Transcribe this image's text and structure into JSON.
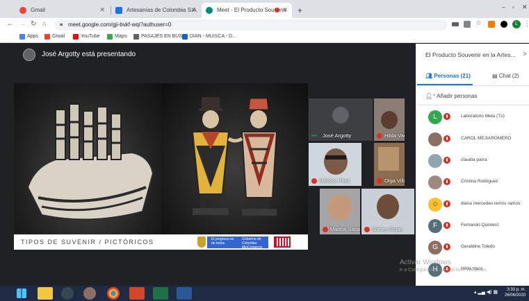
{
  "browser": {
    "tabs": [
      {
        "label": "Gmail",
        "active": false,
        "favicon_color": "#ea4335"
      },
      {
        "label": "Artesanías de Colombia S.A. - Co",
        "active": false,
        "favicon_color": "#1a73e8"
      },
      {
        "label": "Meet - El Producto Souvenir",
        "active": true,
        "favicon_color": "#00897b"
      }
    ],
    "new_tab": "+",
    "url": "meet.google.com/gji-bvkf-wqi?authuser=0",
    "profile_initial": "L",
    "bookmarks": [
      {
        "label": "Apps",
        "color": "#4285f4"
      },
      {
        "label": "Gmail",
        "color": "#ea4335"
      },
      {
        "label": "YouTube",
        "color": "#ff0000"
      },
      {
        "label": "Maps",
        "color": "#34a853"
      },
      {
        "label": "PASAJES EN BUS",
        "color": "#5f6368"
      },
      {
        "label": "DIAN - MUISCA - D...",
        "color": "#1565c0"
      }
    ]
  },
  "meet": {
    "presenting_label": "José Argotty está presentando",
    "slide_caption": "TIPOS DE SUVENIR / PICTÓRICOS",
    "gov_logo_text1": "El progreso es de todos",
    "gov_logo_text2": "Gobierno de Colombia MinComercio",
    "participants": [
      {
        "name": "José Argotty",
        "muted": false
      },
      {
        "name": "Hilda Vaca",
        "muted": true
      },
      {
        "name": "Melissa Páez",
        "muted": true
      },
      {
        "name": "Olga Villabona",
        "muted": true
      },
      {
        "name": "Martha Sanab...",
        "muted": true
      },
      {
        "name": "Shirley Rojas",
        "muted": true
      }
    ]
  },
  "panel": {
    "title": "El Producto Souvenir en la Artes...",
    "close": ">",
    "people_tab": "Personas (21)",
    "chat_tab": "Chat (2)",
    "add_people": "Añadir personas",
    "people": [
      {
        "name": "Laboratorio Meta (Tú)",
        "initial": "L",
        "color": "#33a852"
      },
      {
        "name": "CAROL MEJIAROMERO",
        "initial": "",
        "color": "#8d6e63"
      },
      {
        "name": "claudia parra",
        "initial": "",
        "color": "#90a4ae"
      },
      {
        "name": "Cristina Rodriguez",
        "initial": "",
        "color": "#a1887f"
      },
      {
        "name": "diana mercedes lemos ramos",
        "initial": "",
        "color": "#fbc02d"
      },
      {
        "name": "Fernando Quintero",
        "initial": "F",
        "color": "#546e7a"
      },
      {
        "name": "Geraldine Toledo",
        "initial": "G",
        "color": "#8d6e63"
      },
      {
        "name": "Hilda Vaca",
        "initial": "H",
        "color": "#546e7a"
      }
    ]
  },
  "windows": {
    "activate_title": "Activar Windows",
    "activate_sub": "Ir a Configuración para activar Windows.",
    "clock_time": "3:33 p. m.",
    "clock_date": "26/06/2020"
  }
}
